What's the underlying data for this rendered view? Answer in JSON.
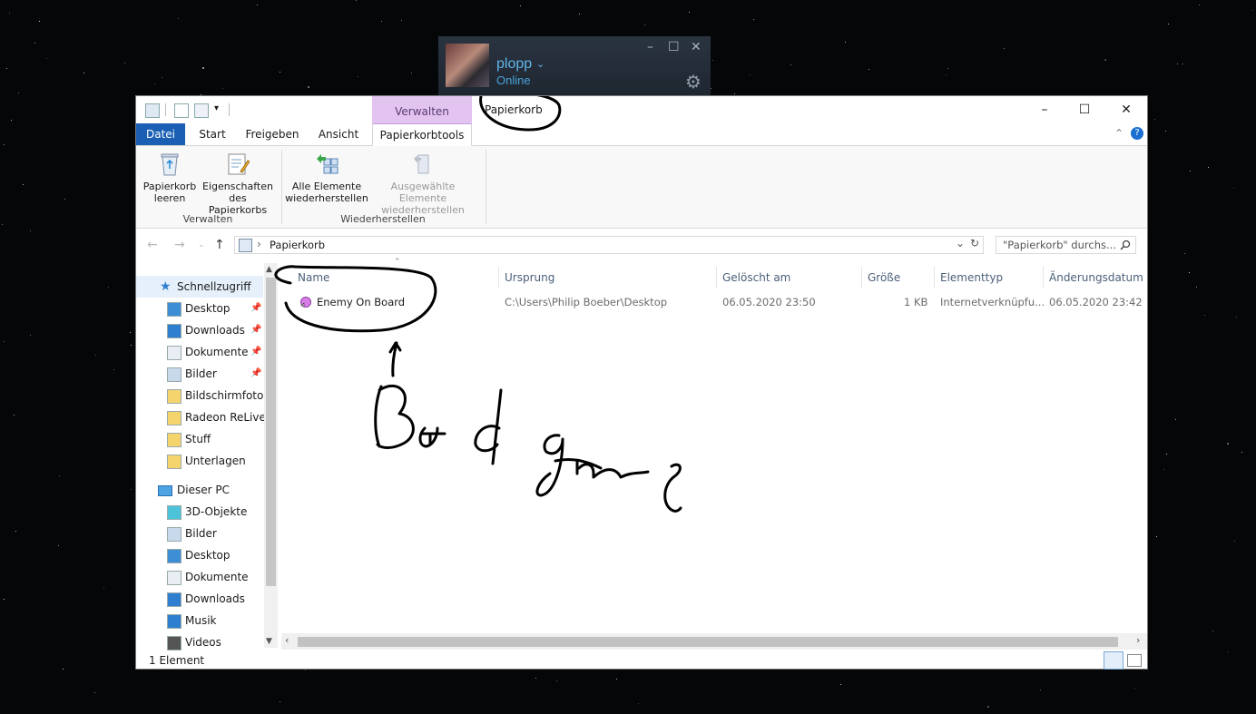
{
  "steam": {
    "user_name": "plopp",
    "status": "Online"
  },
  "window": {
    "title": "Papierkorb",
    "contextual_tab_group": "Verwalten",
    "tabs": [
      "Datei",
      "Start",
      "Freigeben",
      "Ansicht",
      "Papierkorbtools"
    ],
    "ribbon": {
      "buttons": {
        "empty": "Papierkorb\nleeren",
        "properties": "Eigenschaften\ndes Papierkorbs",
        "restore_all": "Alle Elemente\nwiederherstellen",
        "restore_selected": "Ausgewählte Elemente\nwiederherstellen"
      },
      "groups": {
        "manage": "Verwalten",
        "restore": "Wiederherstellen"
      }
    },
    "address": {
      "path": "Papierkorb",
      "search_placeholder": "\"Papierkorb\" durchs..."
    },
    "nav": {
      "quick_access": "Schnellzugriff",
      "quick_items": [
        "Desktop",
        "Downloads",
        "Dokumente",
        "Bilder",
        "Bildschirmfotos",
        "Radeon ReLive",
        "Stuff",
        "Unterlagen"
      ],
      "this_pc": "Dieser PC",
      "pc_items": [
        "3D-Objekte",
        "Bilder",
        "Desktop",
        "Dokumente",
        "Downloads",
        "Musik",
        "Videos"
      ]
    },
    "columns": [
      "Name",
      "Ursprung",
      "Gelöscht am",
      "Größe",
      "Elementtyp",
      "Änderungsdatum"
    ],
    "files": [
      {
        "name": "Enemy On Board",
        "origin": "C:\\Users\\Philip Boeber\\Desktop",
        "deleted": "06.05.2020 23:50",
        "size": "1 KB",
        "type": "Internetverknüpfu...",
        "modified": "06.05.2020 23:42"
      }
    ],
    "status": "1 Element"
  },
  "icons": {
    "undo": "⟲",
    "back": "←",
    "forward": "→",
    "up": "↑",
    "refresh": "↻",
    "search": "search-icon",
    "help": "?"
  },
  "colors": {
    "accent": "#1a5fb4",
    "manage_tab": "#e3c4f0",
    "link": "#62b5ea"
  }
}
